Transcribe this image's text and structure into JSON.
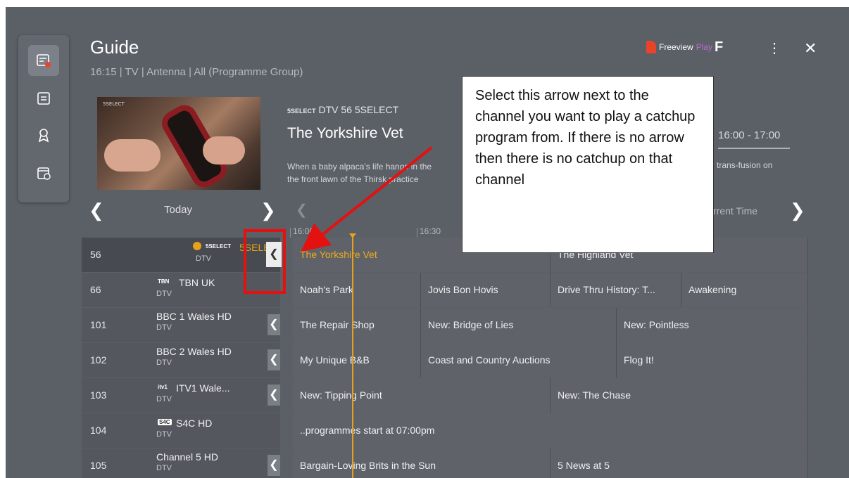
{
  "header": {
    "title": "Guide",
    "subtitle": "16:15 | TV | Antenna | All (Programme Group)"
  },
  "brand": {
    "name": "Freeview",
    "play": "Play"
  },
  "rail": {
    "icons": [
      "guide-icon",
      "list-icon",
      "award-icon",
      "schedule-icon"
    ]
  },
  "preview": {
    "thumb_logo": "5SELECT",
    "channel_logo": "5SELECT",
    "channel_line": "DTV 56 5SELECT",
    "title": "The Yorkshire Vet",
    "description_1": "When a baby alpaca's life hangs in the",
    "description_2": "the front lawn of the Thirsk practice",
    "description_right": "trans-fusion on",
    "time_range": "16:00 - 17:00"
  },
  "nav": {
    "today": "Today",
    "current_time": "rrent Time",
    "times": [
      "16:00",
      "16:30"
    ]
  },
  "callout": {
    "text": "Select this arrow next to the channel you want to play a catchup program from. If there is no arrow then there is no catchup on that channel"
  },
  "channels": [
    {
      "num": "56",
      "logo": "5SELECT",
      "name": "5SELECT",
      "type": "DTV",
      "catchup": true,
      "selected": true,
      "programs": [
        {
          "title": "The Yorkshire Vet",
          "hl": true
        },
        {
          "title": "The Highland Vet"
        }
      ]
    },
    {
      "num": "66",
      "logo": "TBN",
      "name": "TBN UK",
      "type": "DTV",
      "catchup": false,
      "programs": [
        {
          "title": "Noah's Park"
        },
        {
          "title": "Jovis Bon Hovis"
        },
        {
          "title": "Drive Thru History: T..."
        },
        {
          "title": "Awakening"
        }
      ]
    },
    {
      "num": "101",
      "logo": "",
      "name": "BBC 1 Wales HD",
      "type": "DTV",
      "catchup": true,
      "programs": [
        {
          "title": "The Repair Shop"
        },
        {
          "title": "New: Bridge of Lies"
        },
        {
          "title": "New: Pointless"
        }
      ]
    },
    {
      "num": "102",
      "logo": "",
      "name": "BBC 2 Wales HD",
      "type": "DTV",
      "catchup": true,
      "programs": [
        {
          "title": "My Unique B&B"
        },
        {
          "title": "Coast and Country Auctions"
        },
        {
          "title": "Flog It!"
        }
      ]
    },
    {
      "num": "103",
      "logo": "itv1",
      "name": "ITV1 Wale...",
      "type": "DTV",
      "catchup": true,
      "programs": [
        {
          "title": "New: Tipping Point"
        },
        {
          "title": "New: The Chase"
        }
      ]
    },
    {
      "num": "104",
      "logo": "S4C",
      "name": "S4C HD",
      "type": "DTV",
      "catchup": false,
      "programs": [
        {
          "title": "..programmes start at 07:00pm"
        }
      ]
    },
    {
      "num": "105",
      "logo": "",
      "name": "Channel 5 HD",
      "type": "DTV",
      "catchup": true,
      "programs": [
        {
          "title": "Bargain-Loving Brits in the Sun"
        },
        {
          "title": "5 News at 5"
        }
      ]
    }
  ],
  "colors": {
    "background": "#5b5f66",
    "accent": "#e7a11a",
    "annotation_red": "#e41111"
  }
}
